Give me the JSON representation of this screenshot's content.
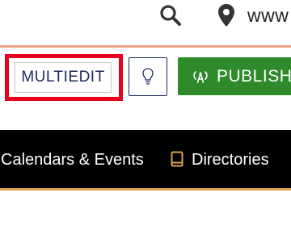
{
  "header": {
    "search_icon": "search-icon",
    "location_icon": "map-pin-icon",
    "url_text": "www"
  },
  "toolbar": {
    "multiedit_label": "MULTIEDIT",
    "tip_icon": "lightbulb-icon",
    "publish_icon": "broadcast-icon",
    "publish_label": "PUBLISH"
  },
  "nav": {
    "calendars_label": "Calendars & Events",
    "directories_icon": "book-icon",
    "directories_label": "Directories"
  },
  "colors": {
    "brand_navy": "#1c2a5c",
    "highlight_red": "#e8001c",
    "publish_green": "#2e8a2a",
    "nav_background": "#000000",
    "accent_gold": "#d9a34c",
    "divider_orange": "#f0a07f"
  }
}
